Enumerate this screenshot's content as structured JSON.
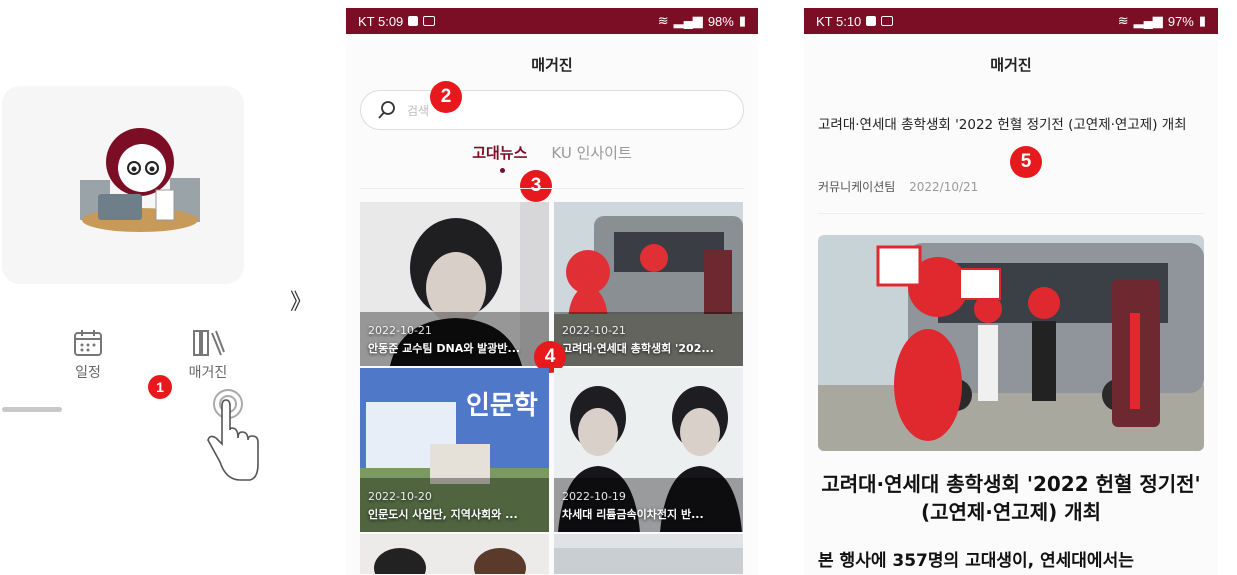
{
  "colors": {
    "brand": "#7b0e25",
    "badge": "#e8191d"
  },
  "panel1": {
    "menu_items": [
      {
        "label": "일정",
        "icon": "calendar-icon"
      },
      {
        "label": "매거진",
        "icon": "books-icon"
      }
    ],
    "step": "1"
  },
  "separator": "》",
  "phone2": {
    "status": {
      "carrier_time": "KT 5:09",
      "battery": "98%"
    },
    "title": "매거진",
    "search": {
      "placeholder": "검색"
    },
    "tabs": [
      {
        "label": "고대뉴스"
      },
      {
        "label": "KU 인사이트"
      }
    ],
    "steps": {
      "search": "2",
      "tabs": "3",
      "grid": "4"
    },
    "tiles": [
      {
        "date": "2022-10-21",
        "title": "안동준 교수팀 DNA와 발광반..."
      },
      {
        "date": "2022-10-21",
        "title": "고려대·연세대 총학생회 '202..."
      },
      {
        "date": "2022-10-20",
        "title": "인문도시 사업단, 지역사회와 ..."
      },
      {
        "date": "2022-10-19",
        "title": "차세대 리튬금속이차전지 반..."
      }
    ],
    "poster_text": "인문학"
  },
  "phone3": {
    "status": {
      "carrier_time": "KT 5:10",
      "battery": "97%"
    },
    "title": "매거진",
    "article": {
      "title": "고려대·연세대 총학생회 '2022 헌혈 정기전 (고연제·연고제) 개최",
      "author": "커뮤니케이션팀",
      "date": "2022/10/21",
      "headline": "고려대·연세대 총학생회 '2022 헌혈 정기전' (고연제·연고제) 개최",
      "subheadline": "본 행사에 357명의 고대생이, 연세대에서는"
    },
    "step": "5"
  }
}
